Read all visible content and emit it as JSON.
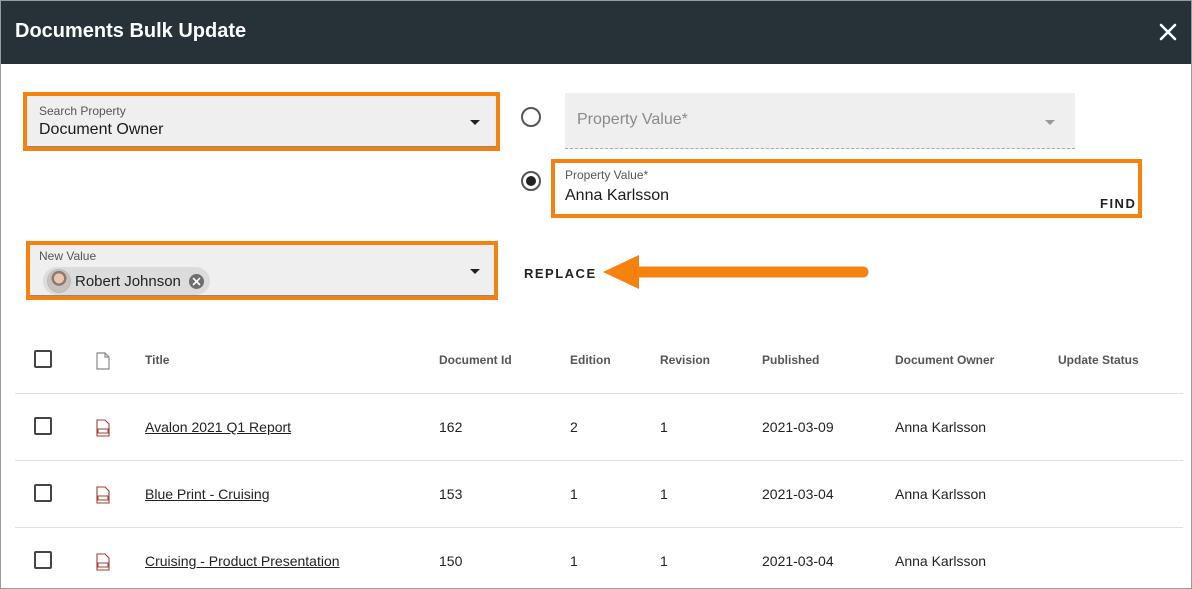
{
  "dialog": {
    "title": "Documents Bulk Update",
    "close_icon": "close-icon"
  },
  "search_property": {
    "label": "Search Property",
    "value": "Document Owner"
  },
  "property_value_select": {
    "placeholder": "Property Value*",
    "selected": false
  },
  "property_value_text": {
    "label": "Property Value*",
    "value": "Anna Karlsson",
    "selected": true,
    "find_label": "FIND"
  },
  "new_value": {
    "label": "New Value",
    "chip_label": "Robert Johnson"
  },
  "replace_label": "REPLACE",
  "colors": {
    "titlebar": "#263238",
    "highlight": "#f5820f",
    "field_bg": "#efefef"
  },
  "table": {
    "headers": {
      "title": "Title",
      "document_id": "Document Id",
      "edition": "Edition",
      "revision": "Revision",
      "published": "Published",
      "document_owner": "Document Owner",
      "update_status": "Update Status"
    },
    "rows": [
      {
        "title": "Avalon 2021 Q1 Report",
        "document_id": "162",
        "edition": "2",
        "revision": "1",
        "published": "2021-03-09",
        "document_owner": "Anna Karlsson",
        "update_status": ""
      },
      {
        "title": "Blue Print - Cruising",
        "document_id": "153",
        "edition": "1",
        "revision": "1",
        "published": "2021-03-04",
        "document_owner": "Anna Karlsson",
        "update_status": ""
      },
      {
        "title": "Cruising - Product Presentation",
        "document_id": "150",
        "edition": "1",
        "revision": "1",
        "published": "2021-03-04",
        "document_owner": "Anna Karlsson",
        "update_status": ""
      }
    ]
  }
}
